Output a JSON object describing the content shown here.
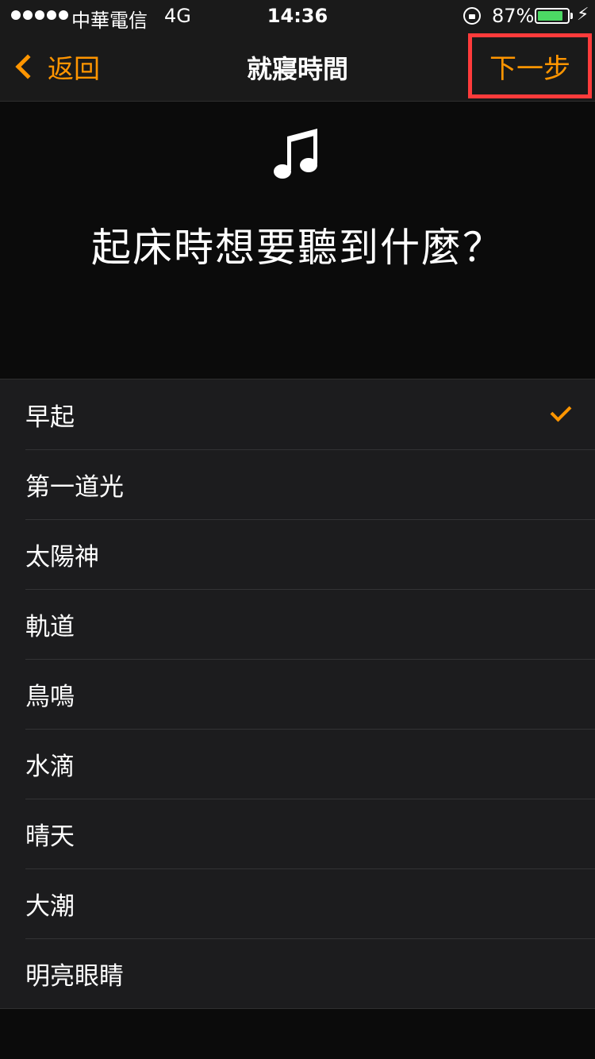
{
  "status_bar": {
    "carrier": "中華電信",
    "network": "4G",
    "time": "14:36",
    "battery_percent": "87%",
    "battery_level": 0.87,
    "battery_color": "#4cd964"
  },
  "nav": {
    "back_label": "返回",
    "title": "就寢時間",
    "next_label": "下一步"
  },
  "header": {
    "icon": "music-note-icon",
    "question": "起床時想要聽到什麼？"
  },
  "sounds": {
    "selected_index": 0,
    "items": [
      {
        "label": "早起"
      },
      {
        "label": "第一道光"
      },
      {
        "label": "太陽神"
      },
      {
        "label": "軌道"
      },
      {
        "label": "鳥鳴"
      },
      {
        "label": "水滴"
      },
      {
        "label": "晴天"
      },
      {
        "label": "大潮"
      },
      {
        "label": "明亮眼睛"
      }
    ]
  },
  "colors": {
    "accent": "#ff9500",
    "highlight_box": "#ff3b3b"
  }
}
